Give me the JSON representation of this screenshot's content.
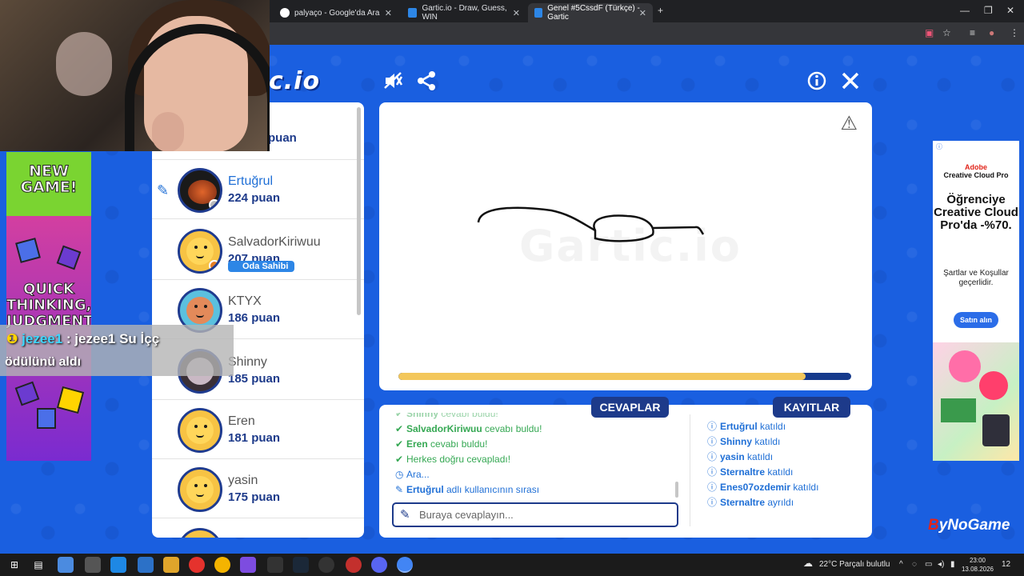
{
  "browser": {
    "tabs": [
      {
        "title": "palyaço - Google'da Ara",
        "favicon_color": "#ffffff",
        "active": false
      },
      {
        "title": "Gartic.io - Draw, Guess, WIN",
        "favicon_color": "#2d86e6",
        "active": false
      },
      {
        "title": "Genel #5CssdF (Türkçe) - Gartic",
        "favicon_color": "#2d86e6",
        "active": true
      }
    ]
  },
  "game": {
    "logo_text": "c.io",
    "players": [
      {
        "name": "",
        "score": "puan",
        "drawing": false
      },
      {
        "name": "Ertuğrul",
        "score": "224 puan",
        "drawing": true,
        "avatar_color": "#c4522a"
      },
      {
        "name": "SalvadorKiriwuu",
        "score": "207 puan",
        "drawing": false,
        "badge": "Oda Sahibi",
        "avatar_color": "#f7c344"
      },
      {
        "name": "KTYX",
        "score": "186 puan",
        "drawing": false,
        "avatar_color": "#e38a5a"
      },
      {
        "name": "Shinny",
        "score": "185 puan",
        "drawing": false,
        "avatar_color": "#5d4a55"
      },
      {
        "name": "Eren",
        "score": "181 puan",
        "drawing": false,
        "avatar_color": "#f7c344"
      },
      {
        "name": "yasin",
        "score": "175 puan",
        "drawing": false,
        "avatar_color": "#f7c344"
      }
    ],
    "canvas_watermark": "Gartic.io",
    "timer_fraction": 0.9,
    "tabs": {
      "answers": "CEVAPLAR",
      "logs": "KAYITLAR"
    },
    "answers": [
      {
        "type": "ok",
        "user": "Shinny",
        "text": " cevabı buldu!"
      },
      {
        "type": "ok",
        "user": "SalvadorKiriwuu",
        "text": " cevabı buldu!"
      },
      {
        "type": "ok",
        "user": "Eren",
        "text": " cevabı buldu!"
      },
      {
        "type": "ok",
        "user": "",
        "text": "Herkes doğru cevapladı!"
      },
      {
        "type": "clock",
        "user": "",
        "text": "Ara..."
      },
      {
        "type": "pen",
        "user": "Ertuğrul",
        "text": " adlı kullanıcının sırası"
      }
    ],
    "answer_placeholder": "Buraya cevaplayın...",
    "logs": [
      {
        "user": "Ertuğrul",
        "text": " katıldı"
      },
      {
        "user": "Shinny",
        "text": " katıldı"
      },
      {
        "user": "yasin",
        "text": " katıldı"
      },
      {
        "user": "Sternaltre",
        "text": " katıldı"
      },
      {
        "user": "Enes07ozdemir",
        "text": " katıldı"
      },
      {
        "user": "Sternaltre",
        "text": " ayrıldı"
      }
    ]
  },
  "right_ad": {
    "brand_top": "Adobe",
    "brand_bottom": "Creative Cloud Pro",
    "headline": "Öğrenciye Creative Cloud Pro'da -%70.",
    "note": "Şartlar ve Koşullar geçerlidir.",
    "cta": "Satın alın"
  },
  "left_ad": {
    "title": "NEW GAME!",
    "tagline": "QUICK THINKING, JUDGMENT"
  },
  "notification": {
    "user": "jezee1",
    "message": ": jezee1 Su İçç",
    "line2": "ödülünü aldı"
  },
  "watermark_brand": {
    "b": "B",
    "rest": "yNoGame"
  },
  "taskbar": {
    "weather": "22°C  Parçalı bulutlu",
    "time": "23:00",
    "date": "13.08.2026",
    "notif_count": "12"
  }
}
